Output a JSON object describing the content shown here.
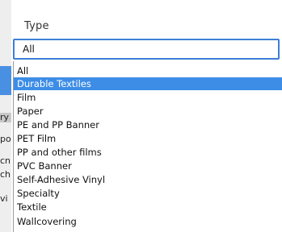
{
  "field": {
    "label": "Type",
    "value": "All"
  },
  "dropdown": {
    "items": [
      "All",
      "Durable Textiles",
      "Film",
      "Paper",
      "PE and PP Banner",
      "PET Film",
      "PP and other films",
      "PVC Banner",
      "Self-Adhesive Vinyl",
      "Specialty",
      "Textile",
      "Wallcovering"
    ],
    "highlighted": "Durable Textiles"
  },
  "background_fragments": [
    "ry",
    "po",
    "cn",
    "ch",
    "vi"
  ],
  "colors": {
    "highlight": "#3d8de6",
    "focus_border": "#3d7fd6"
  }
}
